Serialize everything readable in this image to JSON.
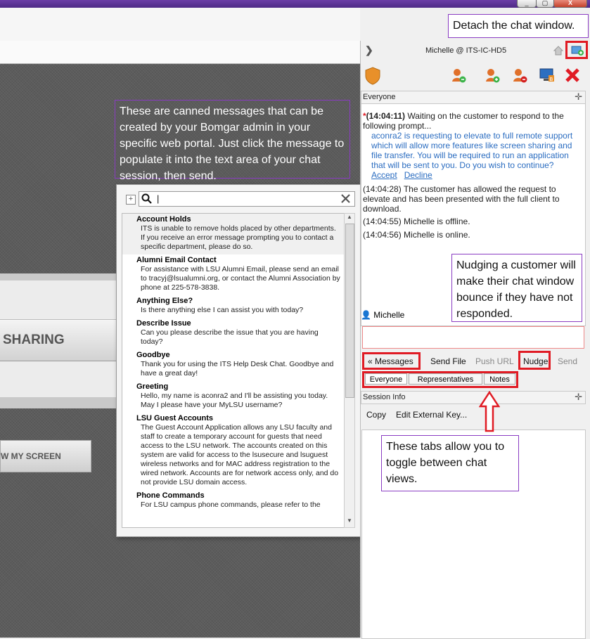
{
  "window": {
    "minimize": "_",
    "maximize": "▢",
    "close": "X"
  },
  "stage": {
    "share_label": "SHARING",
    "show_label": "W MY SCREEN"
  },
  "annotations": {
    "canned": "These are canned messages that can be created by your Bomgar admin in your specific web portal. Just click the message to populate it into the text area of your chat session, then send.",
    "detach": "Detach the chat window.",
    "nudge": "Nudging a customer will make their chat window bounce if they have not responded.",
    "tabs": "These tabs allow you to toggle between chat views."
  },
  "canned_popup": {
    "search_value": "|",
    "items": [
      {
        "title": "Account Holds",
        "body": "ITS is unable to remove holds placed by other departments. If you receive an error message prompting you to contact a specific department, please do so."
      },
      {
        "title": "Alumni Email Contact",
        "body": "For assistance with LSU Alumni Email, please send an email to tracyj@lsualumni.org, or contact the Alumni Association by phone at 225-578-3838."
      },
      {
        "title": "Anything Else?",
        "body": "Is there anything else I can assist you with today?"
      },
      {
        "title": "Describe Issue",
        "body": "Can you please describe the issue that you are having today?"
      },
      {
        "title": "Goodbye",
        "body": "Thank you for using the ITS Help Desk Chat. Goodbye and have a great day!"
      },
      {
        "title": "Greeting",
        "body": "Hello, my name is aconra2 and I'll be assisting you today. May I please have your MyLSU username?"
      },
      {
        "title": "LSU Guest Accounts",
        "body": "The Guest Account Application allows any LSU faculty and staff to create a temporary account for guests that need access to the LSU network. The accounts created on this system are valid for access to the lsusecure and lsuguest wireless networks and for MAC address registration to the wired network. Accounts are for network access only, and do not provide LSU domain access."
      },
      {
        "title": "Phone Commands",
        "body": "For LSU campus phone commands, please refer to the"
      }
    ]
  },
  "session": {
    "rep_title": "Michelle @ ITS-IC-HD5"
  },
  "chat": {
    "header": "Everyone",
    "m1_time": "(14:04:11)",
    "m1_text": "Waiting on the customer to respond to the following prompt...",
    "m1_prompt": "aconra2 is requesting to elevate to full remote support which will allow more features like screen sharing and file transfer.  You will be required to run an application that will be sent to you.  Do you wish to continue?",
    "accept": "Accept",
    "decline": "Decline",
    "m2": "(14:04:28) The customer has allowed the request to elevate and has been presented with the full client to download.",
    "m3": "(14:04:55) Michelle is offline.",
    "m4": "(14:04:56) Michelle is online.",
    "typing_user": "Michelle"
  },
  "actions": {
    "messages": "« Messages",
    "send_file": "Send File",
    "push_url": "Push URL",
    "nudge": "Nudge",
    "send": "Send"
  },
  "tabs": {
    "everyone": "Everyone",
    "representatives": "Representatives",
    "notes": "Notes"
  },
  "session_info": {
    "header": "Session Info",
    "copy": "Copy",
    "edit_key": "Edit External Key..."
  },
  "colors": {
    "accent_purple": "#8a3cc2",
    "highlight_red": "#e01b24",
    "link_blue": "#2a6cc0"
  }
}
